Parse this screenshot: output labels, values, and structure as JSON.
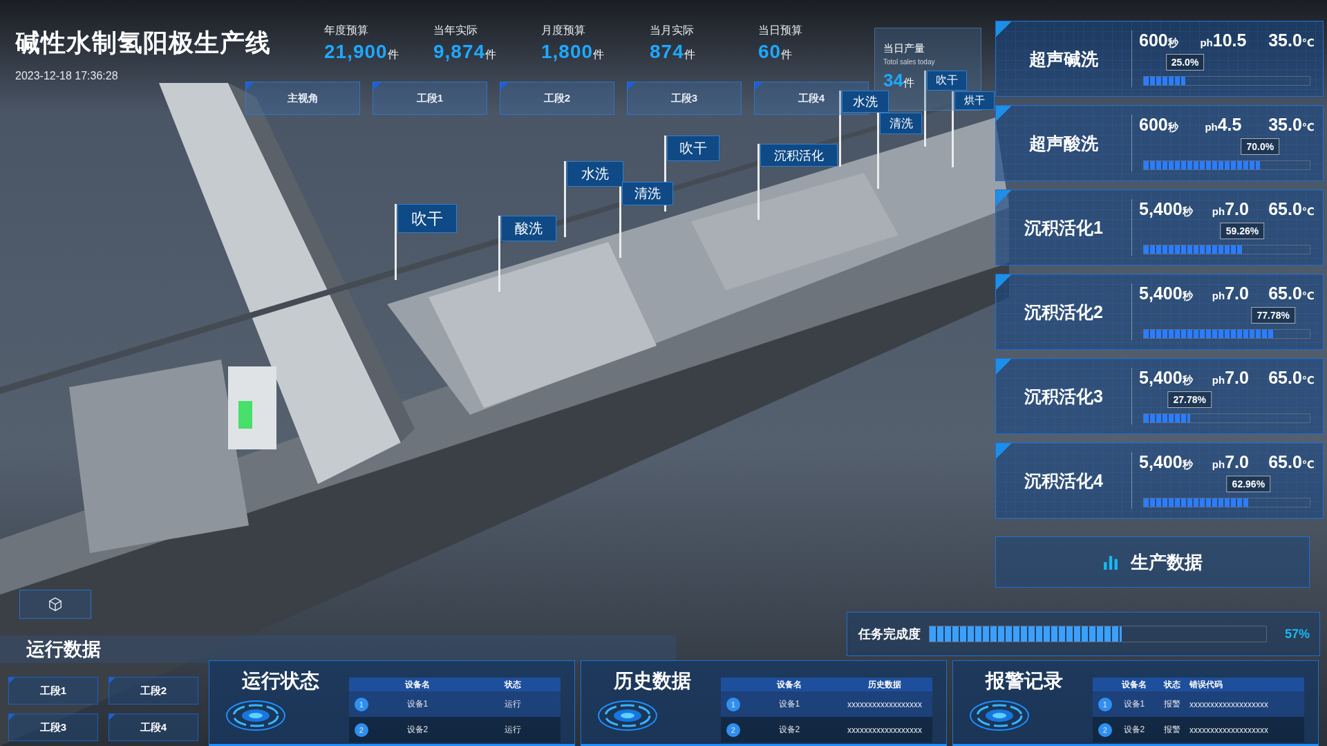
{
  "header": {
    "title": "碱性水制氢阳极生产线",
    "datetime": "2023-12-18 17:36:28"
  },
  "stats": [
    {
      "label": "年度预算",
      "value": "21,900",
      "unit": "件"
    },
    {
      "label": "当年实际",
      "value": "9,874",
      "unit": "件"
    },
    {
      "label": "月度预算",
      "value": "1,800",
      "unit": "件"
    },
    {
      "label": "当月实际",
      "value": "874",
      "unit": "件"
    },
    {
      "label": "当日预算",
      "value": "60",
      "unit": "件"
    }
  ],
  "daily_output": {
    "label": "当日产量",
    "sublabel": "Totol sales today",
    "value": "34",
    "unit": "件"
  },
  "view_tabs": [
    "主视角",
    "工段1",
    "工段2",
    "工段3",
    "工段4"
  ],
  "scene_labels": [
    "吹干",
    "酸洗",
    "水洗",
    "清洗",
    "吹干",
    "沉积活化",
    "水洗",
    "清洗",
    "吹干",
    "烘干"
  ],
  "stations": [
    {
      "name": "超声碱洗",
      "time": "600",
      "time_unit": "秒",
      "ph_label": "ph",
      "ph": "10.5",
      "temp": "35.0",
      "temp_unit": "℃",
      "level": 0.25,
      "percent": "25.0%"
    },
    {
      "name": "超声酸洗",
      "time": "600",
      "time_unit": "秒",
      "ph_label": "ph",
      "ph": "4.5",
      "temp": "35.0",
      "temp_unit": "℃",
      "level": 0.7,
      "percent": "70.0%"
    },
    {
      "name": "沉积活化1",
      "time": "5,400",
      "time_unit": "秒",
      "ph_label": "ph",
      "ph": "7.0",
      "temp": "65.0",
      "temp_unit": "℃",
      "level": 0.5926,
      "percent": "59.26%"
    },
    {
      "name": "沉积活化2",
      "time": "5,400",
      "time_unit": "秒",
      "ph_label": "ph",
      "ph": "7.0",
      "temp": "65.0",
      "temp_unit": "℃",
      "level": 0.7778,
      "percent": "77.78%"
    },
    {
      "name": "沉积活化3",
      "time": "5,400",
      "time_unit": "秒",
      "ph_label": "ph",
      "ph": "7.0",
      "temp": "65.0",
      "temp_unit": "℃",
      "level": 0.2778,
      "percent": "27.78%"
    },
    {
      "name": "沉积活化4",
      "time": "5,400",
      "time_unit": "秒",
      "ph_label": "ph",
      "ph": "7.0",
      "temp": "65.0",
      "temp_unit": "℃",
      "level": 0.6296,
      "percent": "62.96%"
    }
  ],
  "production_button": "生产数据",
  "task": {
    "label": "任务完成度",
    "level": 0.57,
    "reading": "57%"
  },
  "run_data": {
    "title": "运行数据",
    "sections": [
      "工段1",
      "工段2",
      "工段3",
      "工段4"
    ]
  },
  "panels": [
    {
      "title": "运行状态",
      "columns": [
        "设备名",
        "状态"
      ],
      "rows": [
        {
          "index": "1",
          "cells": [
            "设备1",
            "运行"
          ]
        },
        {
          "index": "2",
          "cells": [
            "设备2",
            "运行"
          ]
        }
      ]
    },
    {
      "title": "历史数据",
      "columns": [
        "设备名",
        "历史数据"
      ],
      "rows": [
        {
          "index": "1",
          "cells": [
            "设备1",
            "xxxxxxxxxxxxxxxxxx"
          ]
        },
        {
          "index": "2",
          "cells": [
            "设备2",
            "xxxxxxxxxxxxxxxxxx"
          ]
        }
      ]
    },
    {
      "title": "报警记录",
      "columns": [
        "设备名",
        "状态",
        "错误代码"
      ],
      "rows": [
        {
          "index": "1",
          "cells": [
            "设备1",
            "报警",
            "xxxxxxxxxxxxxxxxxxx"
          ]
        },
        {
          "index": "2",
          "cells": [
            "设备2",
            "报警",
            "xxxxxxxxxxxxxxxxxxx"
          ]
        }
      ]
    }
  ]
}
